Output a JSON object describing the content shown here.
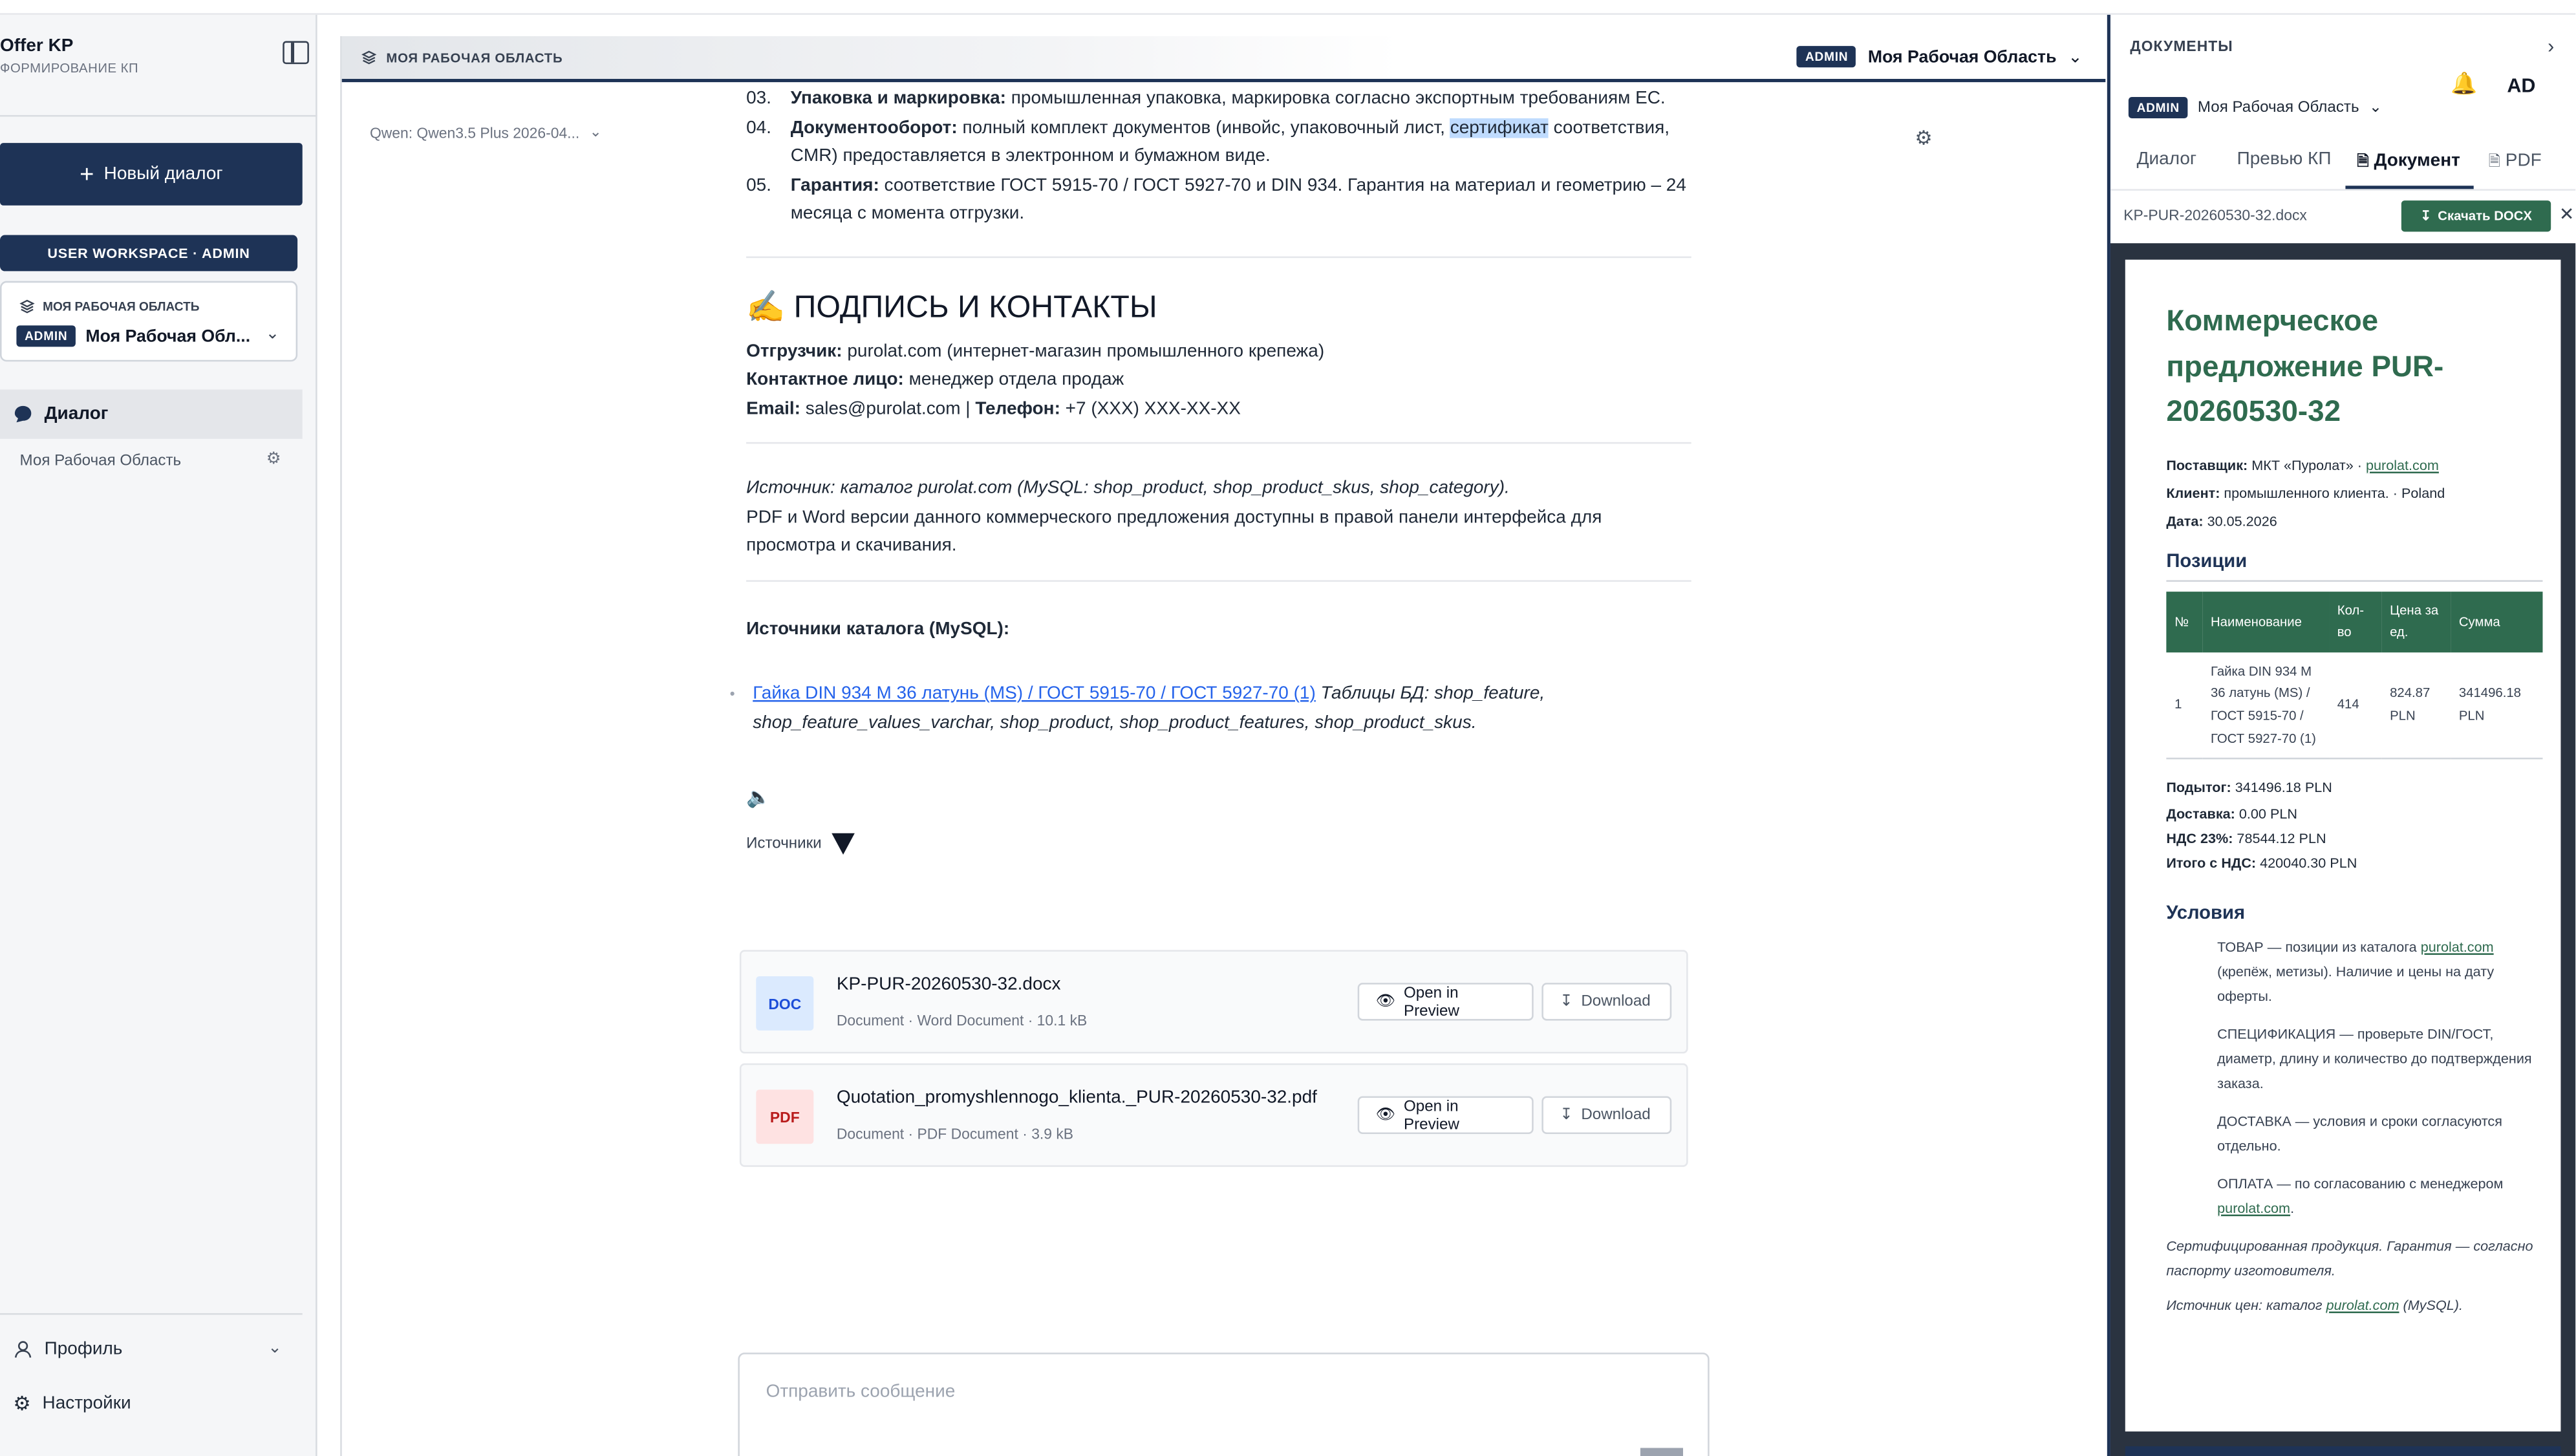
{
  "app": {
    "title": "Offer KP",
    "subtitle": "ФОРМИРОВАНИЕ КП"
  },
  "sidebar": {
    "new_dialog": "Новый диалог",
    "workspace_button": "USER WORKSPACE · ADMIN",
    "workspace_card": {
      "label": "МОЯ РАБОЧАЯ ОБЛАСТЬ",
      "badge": "ADMIN",
      "name": "Моя Рабочая Обл..."
    },
    "nav": {
      "dialog": "Диалог",
      "workspace_item": "Моя Рабочая Область"
    },
    "bottom": {
      "profile": "Профиль",
      "settings": "Настройки"
    }
  },
  "header": {
    "breadcrumb": "МОЯ РАБОЧАЯ ОБЛАСТЬ",
    "badge": "ADMIN",
    "workspace": "Моя Рабочая Область"
  },
  "model": {
    "selected": "Qwen: Qwen3.5 Plus 2026-04..."
  },
  "message": {
    "items": [
      {
        "num": "03.",
        "title": "Упаковка и маркировка:",
        "text": " промышленная упаковка, маркировка согласно экспортным требованиям ЕС."
      },
      {
        "num": "04.",
        "title": "Документооборот:",
        "text_before": " полный комплект документов (инвойс, упаковочный лист, ",
        "highlight": "сертификат",
        "text_after": " соответствия, CMR) предоставляется в электронном и бумажном виде."
      },
      {
        "num": "05.",
        "title": "Гарантия:",
        "text": " соответствие ГОСТ 5915-70 / ГОСТ 5927-70 и DIN 934. Гарантия на материал и геометрию – 24 месяца с момента отгрузки."
      }
    ],
    "sign_heading": "✍️ ПОДПИСЬ И КОНТАКТЫ",
    "shipper_label": "Отгрузчик:",
    "shipper_value": " purolat.com (интернет-магазин промышленного крепежа)",
    "contact_label": "Контактное лицо:",
    "contact_value": " менеджер отдела продаж",
    "email_label": "Email:",
    "email_value": " sales@purolat.com | ",
    "phone_label": "Телефон:",
    "phone_value": " +7 (XXX) XXX-XX-XX",
    "source_note": "Источник: каталог purolat.com (MySQL: shop_product, shop_product_skus, shop_category).",
    "pdf_note": "PDF и Word версии данного коммерческого предложения доступны в правой панели интерфейса для просмотра и скачивания.",
    "catalog_heading": "Источники каталога (MySQL):",
    "catalog_link": "Гайка DIN 934 М 36 латунь (MS) / ГОСТ 5915-70 / ГОСТ 5927-70 (1)",
    "catalog_tables": " Таблицы БД: shop_feature, shop_feature_values_varchar, shop_product, shop_product_features, shop_product_skus.",
    "sources_label": "Источники"
  },
  "files": [
    {
      "type": "DOC",
      "name": "KP-PUR-20260530-32.docx",
      "meta": "Document · Word Document · 10.1 kB",
      "preview": "Open in Preview",
      "download": "Download"
    },
    {
      "type": "PDF",
      "name": "Quotation_promyshlennogo_klienta._PUR-20260530-32.pdf",
      "meta": "Document · PDF Document · 3.9 kB",
      "preview": "Open in Preview",
      "download": "Download"
    }
  ],
  "composer": {
    "placeholder": "Отправить сообщение"
  },
  "panel": {
    "title": "ДОКУМЕНТЫ",
    "avatar": "AD",
    "badge": "ADMIN",
    "workspace": "Моя Рабочая Область",
    "tabs": [
      "Диалог",
      "Превью КП",
      "Документ",
      "PDF"
    ],
    "active_tab": "Документ",
    "file_name": "KP-PUR-20260530-32.docx",
    "download_docx": "Скачать DOCX",
    "doc": {
      "title": "Коммерческое предложение PUR-20260530-32",
      "supplier_label": "Поставщик:",
      "supplier_value": " МКТ «Пуролат» · ",
      "supplier_link": "purolat.com",
      "client_label": "Клиент:",
      "client_value": " промышленного клиента. · Poland",
      "date_label": "Дата:",
      "date_value": " 30.05.2026",
      "positions_heading": "Позиции",
      "table_headers": [
        "№",
        "Наименование",
        "Кол-во",
        "Цена за ед.",
        "Сумма"
      ],
      "rows": [
        [
          "1",
          "Гайка DIN 934 М 36 латунь (MS) / ГОСТ 5915-70 / ГОСТ 5927-70 (1)",
          "414",
          "824.87 PLN",
          "341496.18 PLN"
        ]
      ],
      "subtotal_label": "Подытог:",
      "subtotal_value": " 341496.18 PLN",
      "delivery_label": "Доставка:",
      "delivery_value": " 0.00 PLN",
      "vat_label": "НДС 23%:",
      "vat_value": " 78544.12 PLN",
      "total_label": "Итого с НДС:",
      "total_value": " 420040.30 PLN",
      "conditions_heading": "Условия",
      "cond_goods_before": "ТОВАР — позиции из каталога ",
      "cond_goods_link": "purolat.com",
      "cond_goods_after": " (крепёж, метизы). Наличие и цены на дату оферты.",
      "cond_spec": "СПЕЦИФИКАЦИЯ — проверьте DIN/ГОСТ, диаметр, длину и количество до подтверждения заказа.",
      "cond_delivery": "ДОСТАВКА — условия и сроки согласуются отдельно.",
      "cond_payment_before": "ОПЛАТА — по согласованию с менеджером ",
      "cond_payment_link": "purolat.com",
      "cond_payment_after": ".",
      "note_cert": "Сертифицированная продукция. Гарантия — согласно паспорту изготовителя.",
      "note_src_before": "Источник цен: каталог ",
      "note_src_link": "purolat.com",
      "note_src_after": " (MySQL)."
    }
  },
  "colors": {
    "navy": "#1e3356",
    "doc_green": "#2f6b4f",
    "highlight": "#bfdbfe"
  }
}
